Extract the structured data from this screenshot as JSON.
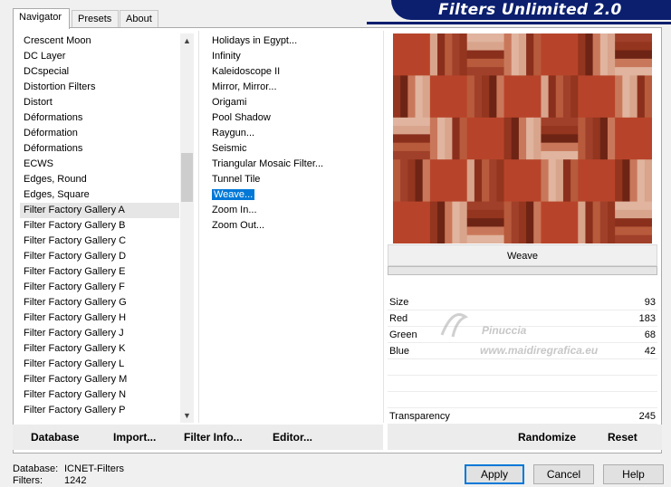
{
  "tabs": [
    {
      "label": "Navigator",
      "active": true
    },
    {
      "label": "Presets",
      "active": false
    },
    {
      "label": "About",
      "active": false
    }
  ],
  "logo_text": "Filters Unlimited 2.0",
  "categories": [
    "Crescent Moon",
    "DC Layer",
    "DCspecial",
    "Distortion Filters",
    "Distort",
    "Déformations",
    "Déformation",
    "Déformations",
    "ECWS",
    "Edges, Round",
    "Edges, Square",
    "Filter Factory Gallery A",
    "Filter Factory Gallery B",
    "Filter Factory Gallery C",
    "Filter Factory Gallery D",
    "Filter Factory Gallery E",
    "Filter Factory Gallery F",
    "Filter Factory Gallery G",
    "Filter Factory Gallery H",
    "Filter Factory Gallery J",
    "Filter Factory Gallery K",
    "Filter Factory Gallery L",
    "Filter Factory Gallery M",
    "Filter Factory Gallery N",
    "Filter Factory Gallery P"
  ],
  "selected_category_index": 11,
  "filters": [
    "Holidays in Egypt...",
    "Infinity",
    "Kaleidoscope II",
    "Mirror, Mirror...",
    "Origami",
    "Pool Shadow",
    "Raygun...",
    "Seismic",
    "Triangular Mosaic Filter...",
    "Tunnel Tile",
    "Weave...",
    "Zoom In...",
    "Zoom Out..."
  ],
  "selected_filter_index": 10,
  "filter_name": "Weave",
  "params": [
    {
      "name": "Size",
      "value": "93"
    },
    {
      "name": "Red",
      "value": "183"
    },
    {
      "name": "Green",
      "value": "68"
    },
    {
      "name": "Blue",
      "value": "42"
    }
  ],
  "transparency": {
    "name": "Transparency",
    "value": "245"
  },
  "watermark": {
    "line1": "Pinuccia",
    "line2": "www.maidiregrafica.eu"
  },
  "toolbar": {
    "database": "Database",
    "import": "Import...",
    "filter_info": "Filter Info...",
    "editor": "Editor..."
  },
  "right_toolbar": {
    "randomize": "Randomize",
    "reset": "Reset"
  },
  "status": {
    "database_label": "Database:",
    "database_value": "ICNET-Filters",
    "filters_label": "Filters:",
    "filters_value": "1242"
  },
  "buttons": {
    "apply": "Apply",
    "cancel": "Cancel",
    "help": "Help"
  },
  "colors": {
    "weave_color": "#b7442a",
    "selection": "#0078d7",
    "logo_bg": "#0b1f6e"
  }
}
